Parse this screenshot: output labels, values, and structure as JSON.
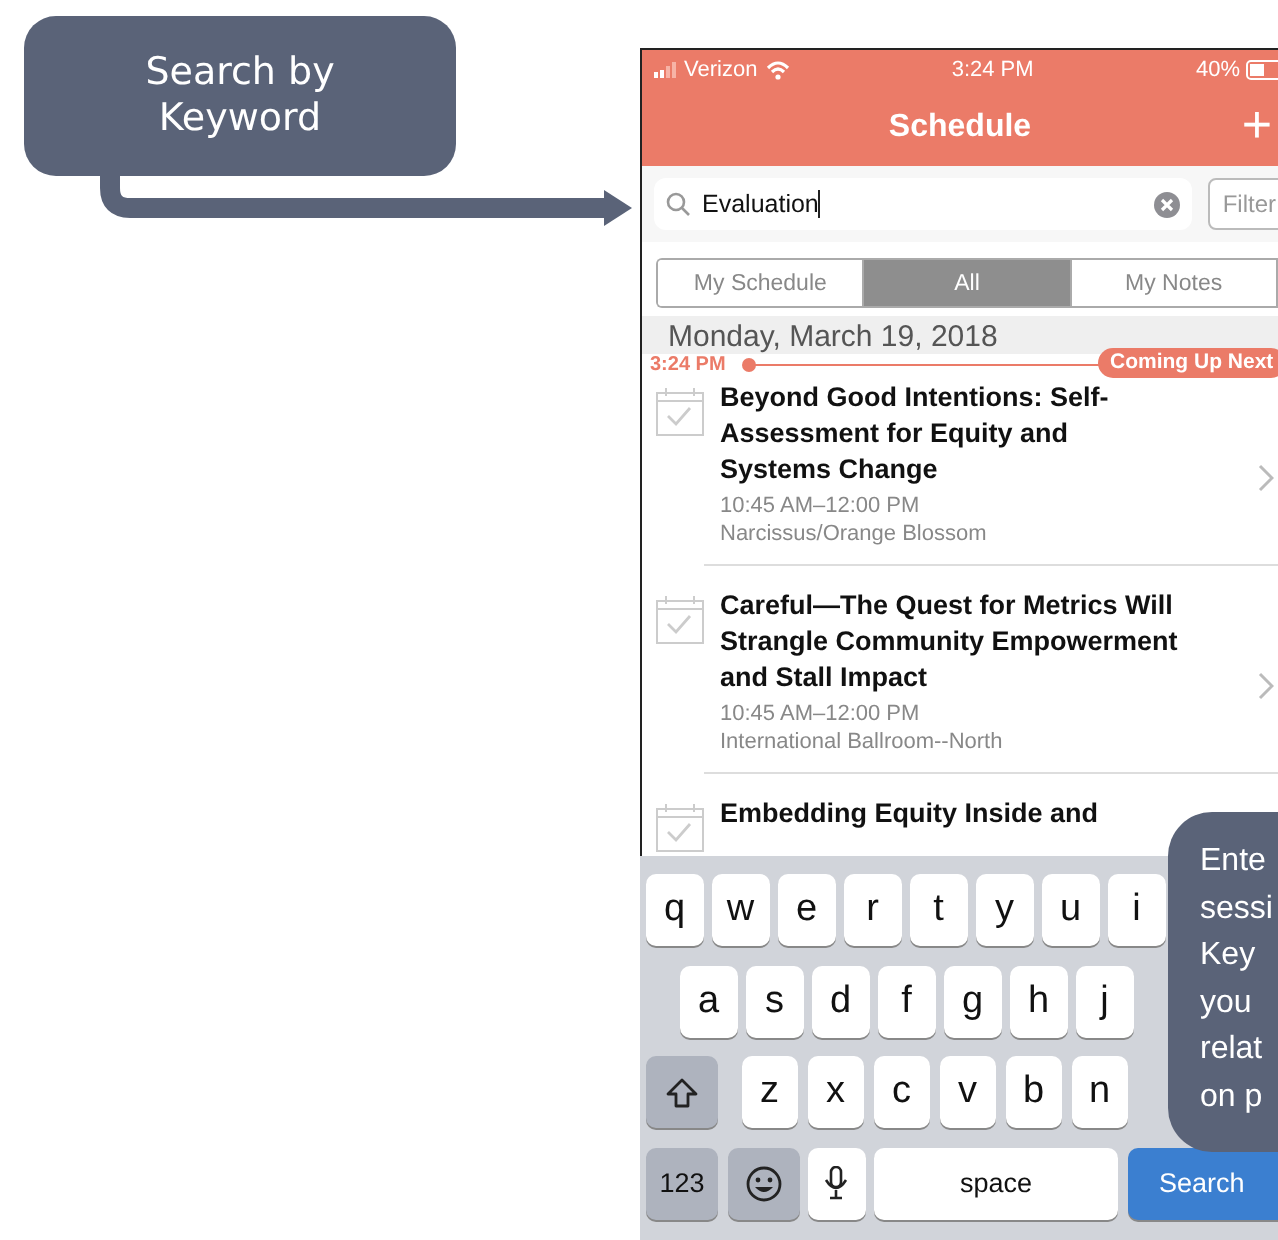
{
  "keyword_callout": {
    "text": "Search by Keyword"
  },
  "status_bar": {
    "carrier": "Verizon",
    "time": "3:24 PM",
    "battery": "40%"
  },
  "nav_bar": {
    "title": "Schedule",
    "action": "+"
  },
  "search": {
    "value": "Evaluation",
    "filter_button": "Filter"
  },
  "segments": [
    {
      "label": "My Schedule",
      "selected": false
    },
    {
      "label": "All",
      "selected": true
    },
    {
      "label": "My Notes",
      "selected": false
    }
  ],
  "date_header": "Monday, March 19, 2018",
  "now_marker": {
    "time": "3:24 PM",
    "badge": "Coming Up Next"
  },
  "sessions": [
    {
      "title": "Beyond Good Intentions: Self-Assessment for Equity and Systems Change",
      "time": "10:45 AM–12:00 PM",
      "room": "Narcissus/Orange Blossom"
    },
    {
      "title": "Careful—The Quest for Metrics Will Strangle Community Empowerment and Stall Impact",
      "time": "10:45 AM–12:00 PM",
      "room": "International Ballroom--North"
    },
    {
      "title": "Embedding Equity Inside and"
    }
  ],
  "keyboard": [
    [
      {
        "kind": "letter",
        "label": "q"
      },
      {
        "kind": "letter",
        "label": "w"
      },
      {
        "kind": "letter",
        "label": "e"
      },
      {
        "kind": "letter",
        "label": "r"
      },
      {
        "kind": "letter",
        "label": "t"
      },
      {
        "kind": "letter",
        "label": "y"
      },
      {
        "kind": "letter",
        "label": "u"
      },
      {
        "kind": "letter",
        "label": "i"
      }
    ],
    [
      {
        "kind": "letter",
        "label": "a"
      },
      {
        "kind": "letter",
        "label": "s"
      },
      {
        "kind": "letter",
        "label": "d"
      },
      {
        "kind": "letter",
        "label": "f"
      },
      {
        "kind": "letter",
        "label": "g"
      },
      {
        "kind": "letter",
        "label": "h"
      },
      {
        "kind": "letter",
        "label": "j"
      }
    ],
    [
      {
        "kind": "shift"
      },
      {
        "kind": "letter",
        "label": "z"
      },
      {
        "kind": "letter",
        "label": "x"
      },
      {
        "kind": "letter",
        "label": "c"
      },
      {
        "kind": "letter",
        "label": "v"
      },
      {
        "kind": "letter",
        "label": "b"
      },
      {
        "kind": "letter",
        "label": "n"
      }
    ],
    [
      {
        "kind": "numbers",
        "label": "123"
      },
      {
        "kind": "emoji"
      },
      {
        "kind": "mic"
      },
      {
        "kind": "space",
        "label": "space"
      },
      {
        "kind": "search",
        "label": "Search"
      }
    ]
  ],
  "side_callout": {
    "lines": [
      "Ente",
      "sessi",
      "Key",
      "you",
      "relat",
      "on p"
    ]
  }
}
